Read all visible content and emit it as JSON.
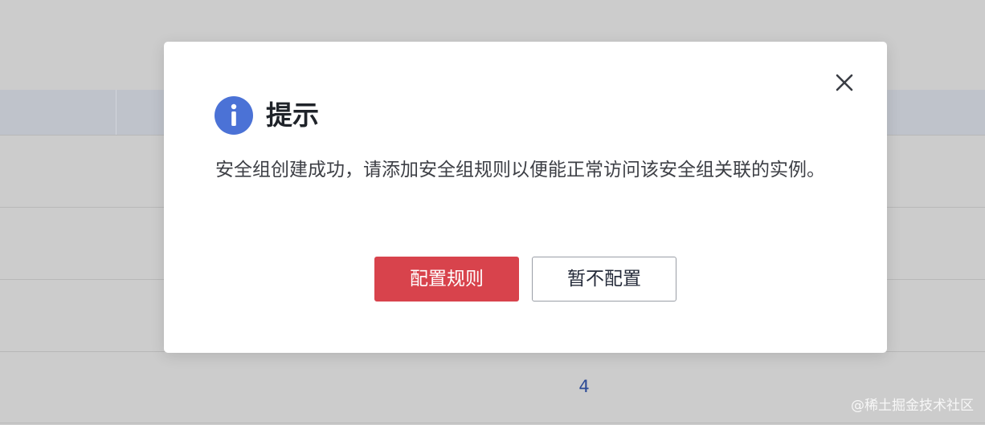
{
  "dialog": {
    "title": "提示",
    "message": "安全组创建成功，请添加安全组规则以便能正常访问该安全组关联的实例。",
    "primary_button": "配置规则",
    "secondary_button": "暂不配置",
    "icon": "info-icon",
    "close_icon": "close-icon"
  },
  "background": {
    "visible_cell_value": "4"
  },
  "watermark": {
    "text": "@稀土掘金技术社区"
  },
  "colors": {
    "overlay": "#cccccc",
    "info_icon": "#4b72d6",
    "primary_button": "#d8434c",
    "link_value": "#2c4a96"
  }
}
